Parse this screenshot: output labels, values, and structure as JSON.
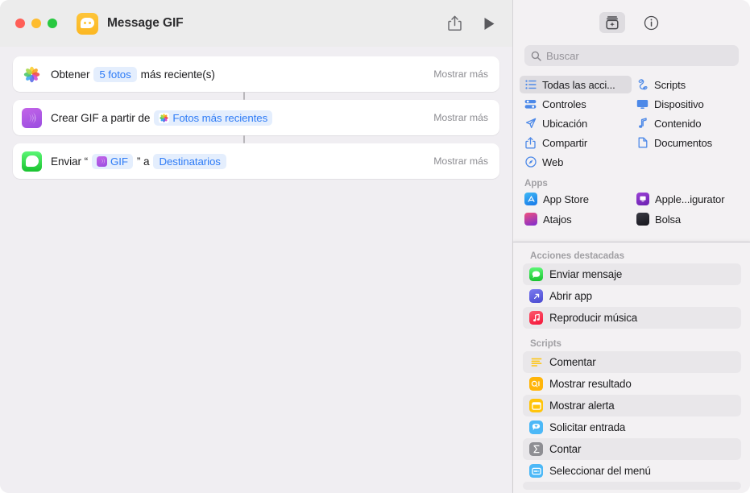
{
  "window": {
    "title": "Message GIF",
    "traffic_lights": [
      "close",
      "minimize",
      "zoom"
    ],
    "app_icon": "messages-app-icon",
    "share_label": "share-icon",
    "run_label": "play-icon"
  },
  "editor": {
    "actions": [
      {
        "icon": "photos-icon",
        "icon_kind": "photos",
        "prefix": "Obtener",
        "token": "5 fotos",
        "token_icon": "",
        "suffix": "más reciente(s)",
        "show_more": "Mostrar más"
      },
      {
        "icon": "gif-icon",
        "icon_kind": "gif",
        "prefix": "Crear GIF a partir de",
        "token": "Fotos más recientes",
        "token_icon": "photos",
        "suffix": "",
        "show_more": "Mostrar más"
      },
      {
        "icon": "messages-icon",
        "icon_kind": "messages",
        "prefix": "Enviar “",
        "token": "GIF",
        "token_icon": "gif",
        "mid": "” a",
        "token2": "Destinatarios",
        "show_more": "Mostrar más"
      }
    ]
  },
  "sidebar": {
    "toolbar": [
      {
        "name": "action-library-icon",
        "label": "Biblioteca de acciones",
        "active": true
      },
      {
        "name": "info-icon",
        "label": "Información",
        "active": false
      }
    ],
    "search": {
      "placeholder": "Buscar",
      "value": "",
      "icon": "search-icon"
    },
    "categories": [
      {
        "label": "Todas las acci...",
        "icon": "list-bullet-icon",
        "selected": true
      },
      {
        "label": "Scripts",
        "icon": "scroll-icon",
        "selected": false
      },
      {
        "label": "Controles",
        "icon": "sliders-icon",
        "selected": false
      },
      {
        "label": "Dispositivo",
        "icon": "display-icon",
        "selected": false
      },
      {
        "label": "Ubicación",
        "icon": "paperplane-icon",
        "selected": false
      },
      {
        "label": "Contenido",
        "icon": "music-note-icon",
        "selected": false
      },
      {
        "label": "Compartir",
        "icon": "share-icon",
        "selected": false
      },
      {
        "label": "Documentos",
        "icon": "document-icon",
        "selected": false
      },
      {
        "label": "Web",
        "icon": "compass-icon",
        "selected": false
      }
    ],
    "apps_header": "Apps",
    "apps": [
      {
        "label": "App Store",
        "color": "#1e8bf4"
      },
      {
        "label": "Apple...igurator",
        "color": "#7b2fbe"
      },
      {
        "label": "Atajos",
        "color": "#e0447c"
      },
      {
        "label": "Bolsa",
        "color": "#2b2b35"
      }
    ]
  },
  "overlay": {
    "featured_header": "Acciones destacadas",
    "featured": [
      {
        "label": "Enviar mensaje",
        "icon": "messages-icon",
        "color": "#35c759",
        "alt": true
      },
      {
        "label": "Abrir app",
        "icon": "open-app-icon",
        "color": "#5b5bd6",
        "alt": false
      },
      {
        "label": "Reproducir música",
        "icon": "music-icon",
        "color": "#fa2d48",
        "alt": true
      }
    ],
    "scripts_header": "Scripts",
    "scripts": [
      {
        "label": "Comentar",
        "icon": "comment-lines-icon",
        "color": "#ffffff",
        "alt": true
      },
      {
        "label": "Mostrar resultado",
        "icon": "quicklook-icon",
        "color": "#ffb50a",
        "alt": false
      },
      {
        "label": "Mostrar alerta",
        "icon": "alert-window-icon",
        "color": "#ffc40a",
        "alt": true
      },
      {
        "label": "Solicitar entrada",
        "icon": "ask-input-icon",
        "color": "#4cb8f7",
        "alt": false
      },
      {
        "label": "Contar",
        "icon": "sigma-count-icon",
        "color": "#8e8e93",
        "alt": true
      },
      {
        "label": "Seleccionar del menú",
        "icon": "menu-select-icon",
        "color": "#4cb8f7",
        "alt": false
      }
    ]
  },
  "colors": {
    "accent_blue": "#2f7cf6",
    "token_bg": "#e4eefd",
    "canvas": "#f0eef2",
    "sidebar": "#f3f1f3",
    "titlebar": "#ececec"
  }
}
